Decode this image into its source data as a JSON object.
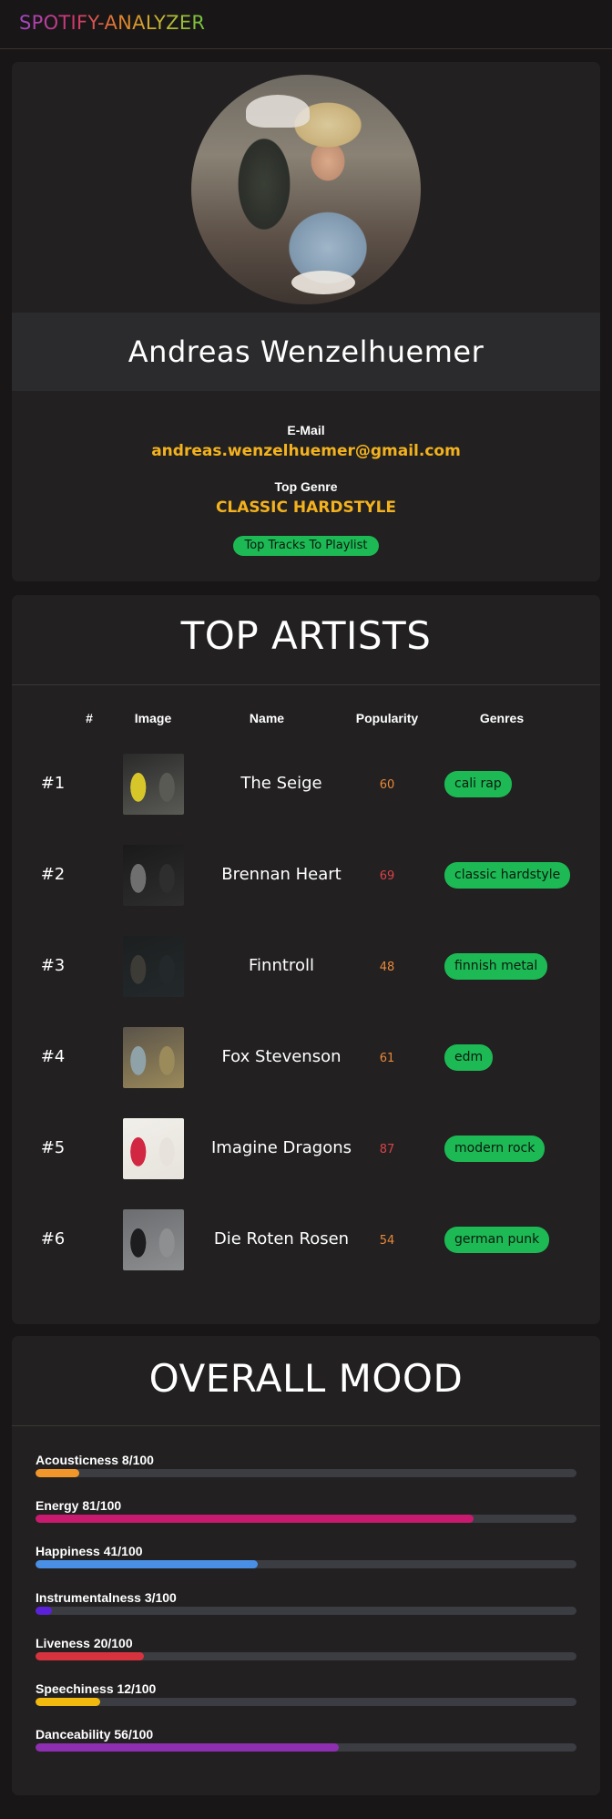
{
  "brand": {
    "name": "SPOTIFY-ANALYZER"
  },
  "profile": {
    "name": "Andreas Wenzelhuemer",
    "email_label": "E-Mail",
    "email": "andreas.wenzelhuemer@gmail.com",
    "genre_label": "Top Genre",
    "top_genre": "CLASSIC HARDSTYLE",
    "playlist_button": "Top Tracks To Playlist"
  },
  "top_artists": {
    "title": "TOP ARTISTS",
    "columns": [
      "#",
      "Image",
      "Name",
      "Popularity",
      "Genres"
    ],
    "rows": [
      {
        "rank": "#1",
        "name": "The Seige",
        "popularity": "60",
        "pop_color": "#e8893a",
        "genre": "cali rap",
        "thumb": [
          "#2a2a2a",
          "#d7c62a",
          "#5a5a55"
        ]
      },
      {
        "rank": "#2",
        "name": "Brennan Heart",
        "popularity": "69",
        "pop_color": "#d8434a",
        "genre": "classic hardstyle",
        "thumb": [
          "#1a1a1a",
          "#6f6f6f",
          "#2e2e2e"
        ]
      },
      {
        "rank": "#3",
        "name": "Finntroll",
        "popularity": "48",
        "pop_color": "#e8893a",
        "genre": "finnish metal",
        "thumb": [
          "#1c1f20",
          "#3c3b36",
          "#23292b"
        ]
      },
      {
        "rank": "#4",
        "name": "Fox Stevenson",
        "popularity": "61",
        "pop_color": "#e8893a",
        "genre": "edm",
        "thumb": [
          "#5a5349",
          "#8fa2a8",
          "#9b8a5a"
        ]
      },
      {
        "rank": "#5",
        "name": "Imagine Dragons",
        "popularity": "87",
        "pop_color": "#d8434a",
        "genre": "modern rock",
        "thumb": [
          "#f1efea",
          "#d22742",
          "#e7e3dc"
        ]
      },
      {
        "rank": "#6",
        "name": "Die Roten Rosen",
        "popularity": "54",
        "pop_color": "#e8893a",
        "genre": "german punk",
        "thumb": [
          "#6b6d70",
          "#1d1d1f",
          "#8d8f91"
        ]
      }
    ]
  },
  "mood": {
    "title": "OVERALL MOOD",
    "items": [
      {
        "label": "Acousticness 8/100",
        "value": 8,
        "color": "#f0962a"
      },
      {
        "label": "Energy 81/100",
        "value": 81,
        "color": "#c81b6f"
      },
      {
        "label": "Happiness 41/100",
        "value": 41,
        "color": "#4a8fe6"
      },
      {
        "label": "Instrumentalness 3/100",
        "value": 3,
        "color": "#5b21d8"
      },
      {
        "label": "Liveness 20/100",
        "value": 20,
        "color": "#d6333f"
      },
      {
        "label": "Speechiness 12/100",
        "value": 12,
        "color": "#f2b90f"
      },
      {
        "label": "Danceability 56/100",
        "value": 56,
        "color": "#8e2eb1"
      }
    ]
  }
}
